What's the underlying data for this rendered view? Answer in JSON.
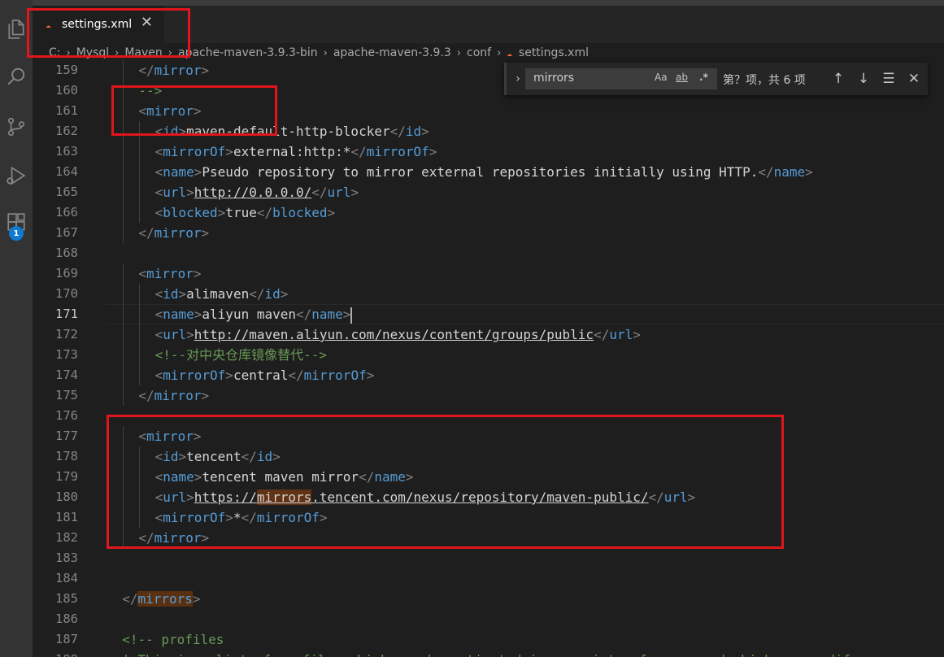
{
  "colors": {
    "tag": "#569cd6",
    "bracket": "#808080",
    "text": "#d4d4d4",
    "comment": "#6a9955",
    "highlight": "#e0161c"
  },
  "activity_bar": {
    "icons": [
      "explorer-icon",
      "search-icon",
      "source-control-icon",
      "run-debug-icon",
      "extensions-icon"
    ],
    "badge": "1"
  },
  "tab": {
    "icon": "rss-icon",
    "label": "settings.xml",
    "close": "✕"
  },
  "breadcrumb": {
    "items": [
      "C:",
      "Mysql",
      "Maven",
      "apache-maven-3.9.3-bin",
      "apache-maven-3.9.3",
      "conf",
      "settings.xml"
    ],
    "separator": "›"
  },
  "find_widget": {
    "query": "mirrors",
    "match_case": "Aa",
    "whole_word": "ab",
    "regex": ".*",
    "result": "第？项，共 6 项",
    "prev_icon": "arrow-up-icon",
    "next_icon": "arrow-down-icon",
    "selection_icon": "find-in-selection-icon",
    "close_icon": "close-icon"
  },
  "editor": {
    "active_line": "171",
    "lines": [
      {
        "num": "159",
        "indent": 2,
        "segs": [
          [
            "br",
            "</"
          ],
          [
            "tag",
            "mirror"
          ],
          [
            "br",
            ">"
          ]
        ]
      },
      {
        "num": "160",
        "indent": 2,
        "segs": [
          [
            "cmt",
            "-->"
          ]
        ]
      },
      {
        "num": "161",
        "indent": 2,
        "segs": [
          [
            "br",
            "<"
          ],
          [
            "tag",
            "mirror"
          ],
          [
            "br",
            ">"
          ]
        ]
      },
      {
        "num": "162",
        "indent": 3,
        "segs": [
          [
            "br",
            "<"
          ],
          [
            "tag",
            "id"
          ],
          [
            "br",
            ">"
          ],
          [
            "txt",
            "maven-default-http-blocker"
          ],
          [
            "br",
            "</"
          ],
          [
            "tag",
            "id"
          ],
          [
            "br",
            ">"
          ]
        ]
      },
      {
        "num": "163",
        "indent": 3,
        "segs": [
          [
            "br",
            "<"
          ],
          [
            "tag",
            "mirrorOf"
          ],
          [
            "br",
            ">"
          ],
          [
            "txt",
            "external:http:*"
          ],
          [
            "br",
            "</"
          ],
          [
            "tag",
            "mirrorOf"
          ],
          [
            "br",
            ">"
          ]
        ]
      },
      {
        "num": "164",
        "indent": 3,
        "segs": [
          [
            "br",
            "<"
          ],
          [
            "tag",
            "name"
          ],
          [
            "br",
            ">"
          ],
          [
            "txt",
            "Pseudo repository to mirror external repositories initially using HTTP."
          ],
          [
            "br",
            "</"
          ],
          [
            "tag",
            "name"
          ],
          [
            "br",
            ">"
          ]
        ]
      },
      {
        "num": "165",
        "indent": 3,
        "segs": [
          [
            "br",
            "<"
          ],
          [
            "tag",
            "url"
          ],
          [
            "br",
            ">"
          ],
          [
            "url",
            "http://0.0.0.0/"
          ],
          [
            "br",
            "</"
          ],
          [
            "tag",
            "url"
          ],
          [
            "br",
            ">"
          ]
        ]
      },
      {
        "num": "166",
        "indent": 3,
        "segs": [
          [
            "br",
            "<"
          ],
          [
            "tag",
            "blocked"
          ],
          [
            "br",
            ">"
          ],
          [
            "txt",
            "true"
          ],
          [
            "br",
            "</"
          ],
          [
            "tag",
            "blocked"
          ],
          [
            "br",
            ">"
          ]
        ]
      },
      {
        "num": "167",
        "indent": 2,
        "segs": [
          [
            "br",
            "</"
          ],
          [
            "tag",
            "mirror"
          ],
          [
            "br",
            ">"
          ]
        ]
      },
      {
        "num": "168",
        "indent": 0,
        "segs": []
      },
      {
        "num": "169",
        "indent": 2,
        "segs": [
          [
            "br",
            "<"
          ],
          [
            "tag",
            "mirror"
          ],
          [
            "br",
            ">"
          ]
        ]
      },
      {
        "num": "170",
        "indent": 3,
        "segs": [
          [
            "br",
            "<"
          ],
          [
            "tag",
            "id"
          ],
          [
            "br",
            ">"
          ],
          [
            "txt",
            "alimaven"
          ],
          [
            "br",
            "</"
          ],
          [
            "tag",
            "id"
          ],
          [
            "br",
            ">"
          ]
        ]
      },
      {
        "num": "171",
        "indent": 3,
        "segs": [
          [
            "br",
            "<"
          ],
          [
            "tag",
            "name"
          ],
          [
            "br",
            ">"
          ],
          [
            "txt",
            "aliyun maven"
          ],
          [
            "br",
            "</"
          ],
          [
            "tag",
            "name"
          ],
          [
            "br",
            ">"
          ],
          [
            "cursor",
            ""
          ]
        ]
      },
      {
        "num": "172",
        "indent": 3,
        "segs": [
          [
            "br",
            "<"
          ],
          [
            "tag",
            "url"
          ],
          [
            "br",
            ">"
          ],
          [
            "url",
            "http://maven.aliyun.com/nexus/content/groups/public"
          ],
          [
            "br",
            "</"
          ],
          [
            "tag",
            "url"
          ],
          [
            "br",
            ">"
          ]
        ]
      },
      {
        "num": "173",
        "indent": 3,
        "segs": [
          [
            "cmt",
            "<!--对中央仓库镜像替代-->"
          ]
        ]
      },
      {
        "num": "174",
        "indent": 3,
        "segs": [
          [
            "br",
            "<"
          ],
          [
            "tag",
            "mirrorOf"
          ],
          [
            "br",
            ">"
          ],
          [
            "txt",
            "central"
          ],
          [
            "br",
            "</"
          ],
          [
            "tag",
            "mirrorOf"
          ],
          [
            "br",
            ">"
          ]
        ]
      },
      {
        "num": "175",
        "indent": 2,
        "segs": [
          [
            "br",
            "</"
          ],
          [
            "tag",
            "mirror"
          ],
          [
            "br",
            ">"
          ]
        ]
      },
      {
        "num": "176",
        "indent": 0,
        "segs": []
      },
      {
        "num": "177",
        "indent": 2,
        "segs": [
          [
            "br",
            "<"
          ],
          [
            "tag",
            "mirror"
          ],
          [
            "br",
            ">"
          ]
        ]
      },
      {
        "num": "178",
        "indent": 3,
        "segs": [
          [
            "br",
            "<"
          ],
          [
            "tag",
            "id"
          ],
          [
            "br",
            ">"
          ],
          [
            "txt",
            "tencent"
          ],
          [
            "br",
            "</"
          ],
          [
            "tag",
            "id"
          ],
          [
            "br",
            ">"
          ]
        ]
      },
      {
        "num": "179",
        "indent": 3,
        "segs": [
          [
            "br",
            "<"
          ],
          [
            "tag",
            "name"
          ],
          [
            "br",
            ">"
          ],
          [
            "txt",
            "tencent maven mirror"
          ],
          [
            "br",
            "</"
          ],
          [
            "tag",
            "name"
          ],
          [
            "br",
            ">"
          ]
        ]
      },
      {
        "num": "180",
        "indent": 3,
        "segs": [
          [
            "br",
            "<"
          ],
          [
            "tag",
            "url"
          ],
          [
            "br",
            ">"
          ],
          [
            "url",
            "https://"
          ],
          [
            "urlfind",
            "mirrors"
          ],
          [
            "url",
            ".tencent.com/nexus/repository/maven-public/"
          ],
          [
            "br",
            "</"
          ],
          [
            "tag",
            "url"
          ],
          [
            "br",
            ">"
          ]
        ]
      },
      {
        "num": "181",
        "indent": 3,
        "segs": [
          [
            "br",
            "<"
          ],
          [
            "tag",
            "mirrorOf"
          ],
          [
            "br",
            ">"
          ],
          [
            "txt",
            "*"
          ],
          [
            "br",
            "</"
          ],
          [
            "tag",
            "mirrorOf"
          ],
          [
            "br",
            ">"
          ]
        ]
      },
      {
        "num": "182",
        "indent": 2,
        "segs": [
          [
            "br",
            "</"
          ],
          [
            "tag",
            "mirror"
          ],
          [
            "br",
            ">"
          ]
        ]
      },
      {
        "num": "183",
        "indent": 0,
        "segs": []
      },
      {
        "num": "184",
        "indent": 0,
        "segs": []
      },
      {
        "num": "185",
        "indent": 1,
        "segs": [
          [
            "br",
            "</"
          ],
          [
            "taghl",
            "mirrors"
          ],
          [
            "br",
            ">"
          ]
        ]
      },
      {
        "num": "186",
        "indent": 0,
        "segs": []
      },
      {
        "num": "187",
        "indent": 1,
        "segs": [
          [
            "cmt",
            "<!-- profiles"
          ]
        ]
      },
      {
        "num": "188",
        "indent": 1,
        "segs": [
          [
            "cmt",
            "| This is a list of profiles which can be activated in a variety of ways, and which can modify"
          ]
        ]
      }
    ]
  }
}
